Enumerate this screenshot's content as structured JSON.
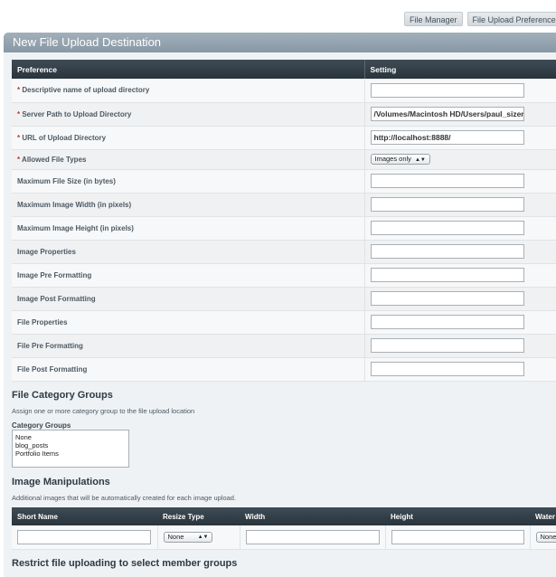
{
  "top_buttons": [
    "File Manager",
    "File Upload Preferences",
    ""
  ],
  "panel_title": "New File Upload Destination",
  "pref_table": {
    "headers": [
      "Preference",
      "Setting"
    ],
    "rows": [
      {
        "label": "Descriptive name of upload directory",
        "required": true,
        "type": "text",
        "value": ""
      },
      {
        "label": "Server Path to Upload Directory",
        "required": true,
        "type": "text",
        "value": "/Volumes/Macintosh HD/Users/paul_sizer/S"
      },
      {
        "label": "URL of Upload Directory",
        "required": true,
        "type": "text",
        "value": "http://localhost:8888/"
      },
      {
        "label": "Allowed File Types",
        "required": true,
        "type": "select",
        "value": "Images only"
      },
      {
        "label": "Maximum File Size (in bytes)",
        "required": false,
        "type": "text",
        "value": ""
      },
      {
        "label": "Maximum Image Width (in pixels)",
        "required": false,
        "type": "text",
        "value": ""
      },
      {
        "label": "Maximum Image Height (in pixels)",
        "required": false,
        "type": "text",
        "value": ""
      },
      {
        "label": "Image Properties",
        "required": false,
        "type": "text",
        "value": ""
      },
      {
        "label": "Image Pre Formatting",
        "required": false,
        "type": "text",
        "value": ""
      },
      {
        "label": "Image Post Formatting",
        "required": false,
        "type": "text",
        "value": ""
      },
      {
        "label": "File Properties",
        "required": false,
        "type": "text",
        "value": ""
      },
      {
        "label": "File Pre Formatting",
        "required": false,
        "type": "text",
        "value": ""
      },
      {
        "label": "File Post Formatting",
        "required": false,
        "type": "text",
        "value": ""
      }
    ]
  },
  "category": {
    "heading": "File Category Groups",
    "description": "Assign one or more category group to the file upload location",
    "label": "Category Groups",
    "options": [
      "None",
      "blog_posts",
      "Portfolio Items"
    ]
  },
  "manipulations": {
    "heading": "Image Manipulations",
    "description": "Additional images that will be automatically created for each image upload.",
    "headers": [
      "Short Name",
      "Resize Type",
      "Width",
      "Height",
      "Water"
    ],
    "resize_value": "None",
    "water_value": "None"
  },
  "restrict_heading": "Restrict file uploading to select member groups"
}
